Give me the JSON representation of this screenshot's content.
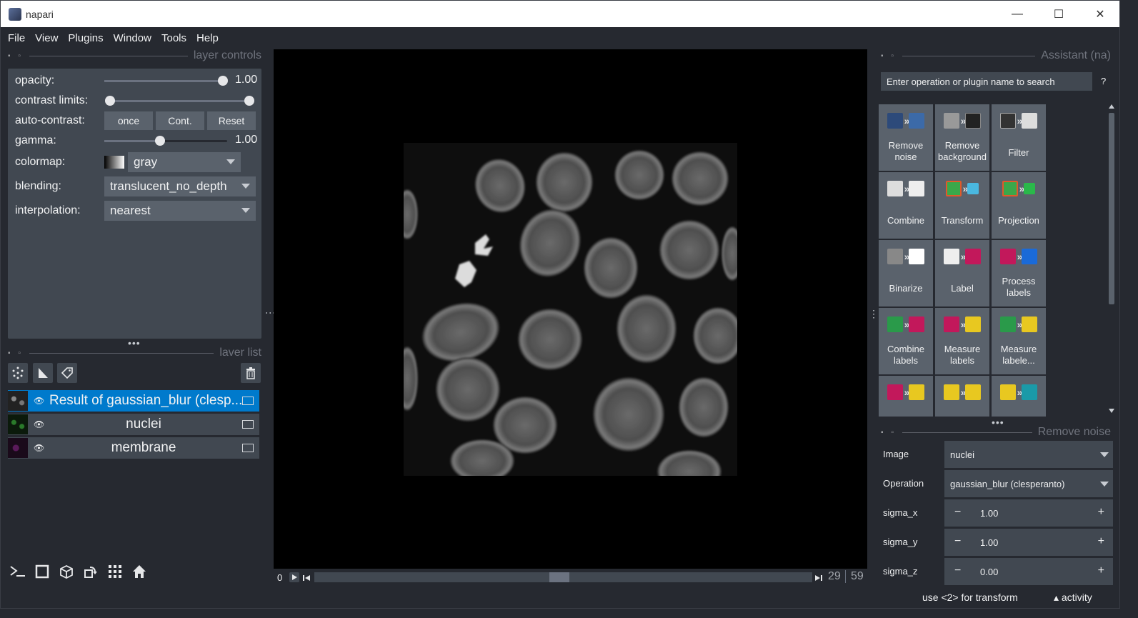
{
  "window": {
    "title": "napari",
    "minimize": "—",
    "maximize": "☐",
    "close": "✕"
  },
  "menu": [
    "File",
    "View",
    "Plugins",
    "Window",
    "Tools",
    "Help"
  ],
  "layer_controls": {
    "title": "layer controls",
    "opacity_label": "opacity:",
    "opacity_value": "1.00",
    "opacity_level": 1.0,
    "contrast_label": "contrast limits:",
    "auto_contrast_label": "auto-contrast:",
    "auto_buttons": [
      "once",
      "Cont.",
      "Reset"
    ],
    "gamma_label": "gamma:",
    "gamma_value": "1.00",
    "colormap_label": "colormap:",
    "colormap_value": "gray",
    "blending_label": "blending:",
    "blending_value": "translucent_no_depth",
    "interpolation_label": "interpolation:",
    "interpolation_value": "nearest"
  },
  "layer_list": {
    "title": "laver list",
    "layers": [
      {
        "name": "Result of gaussian_blur (clesp...",
        "selected": true
      },
      {
        "name": "nuclei",
        "selected": false
      },
      {
        "name": "membrane",
        "selected": false
      }
    ]
  },
  "dims": {
    "start": "0",
    "current": "29",
    "max": "59"
  },
  "assistant": {
    "title": "Assistant (na)",
    "search_placeholder": "Enter operation or plugin name to search",
    "help": "?",
    "tiles": [
      {
        "label": "Remove noise"
      },
      {
        "label": "Remove background"
      },
      {
        "label": "Filter"
      },
      {
        "label": "Combine"
      },
      {
        "label": "Transform"
      },
      {
        "label": "Projection"
      },
      {
        "label": "Binarize"
      },
      {
        "label": "Label"
      },
      {
        "label": "Process labels"
      },
      {
        "label": "Combine labels"
      },
      {
        "label": "Measure labels"
      },
      {
        "label": "Measure labele..."
      },
      {
        "label": ""
      },
      {
        "label": ""
      },
      {
        "label": ""
      }
    ]
  },
  "remove_noise": {
    "title": "Remove noise",
    "image_label": "Image",
    "image_value": "nuclei",
    "operation_label": "Operation",
    "operation_value": "gaussian_blur (clesperanto)",
    "sigma_x_label": "sigma_x",
    "sigma_x_value": "1.00",
    "sigma_y_label": "sigma_y",
    "sigma_y_value": "1.00",
    "sigma_z_label": "sigma_z",
    "sigma_z_value": "0.00"
  },
  "status": {
    "hint": "use <2> for transform",
    "activity": "▴ activity"
  }
}
